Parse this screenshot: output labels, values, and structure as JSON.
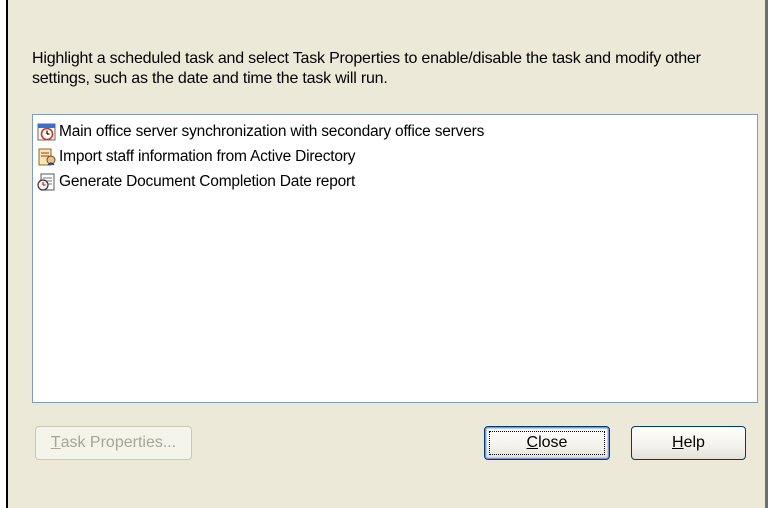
{
  "instructions": "Highlight a scheduled task and select Task Properties to enable/disable the task and modify other settings, such as the date and time the task will run.",
  "tasks": [
    {
      "label": "Main office server synchronization with secondary office servers",
      "icon": "clock-icon"
    },
    {
      "label": "Import staff information from Active Directory",
      "icon": "directory-import-icon"
    },
    {
      "label": "Generate Document Completion Date report",
      "icon": "report-icon"
    }
  ],
  "buttons": {
    "task_properties": {
      "mnemonic": "T",
      "rest": "ask Properties...",
      "enabled": false
    },
    "close": {
      "mnemonic": "C",
      "rest": "lose"
    },
    "help": {
      "mnemonic": "H",
      "rest": "elp"
    }
  },
  "colors": {
    "dialog_bg": "#ece9d8",
    "list_border": "#7f9db9",
    "button_border": "#003c74",
    "disabled_text": "#a7a595"
  }
}
